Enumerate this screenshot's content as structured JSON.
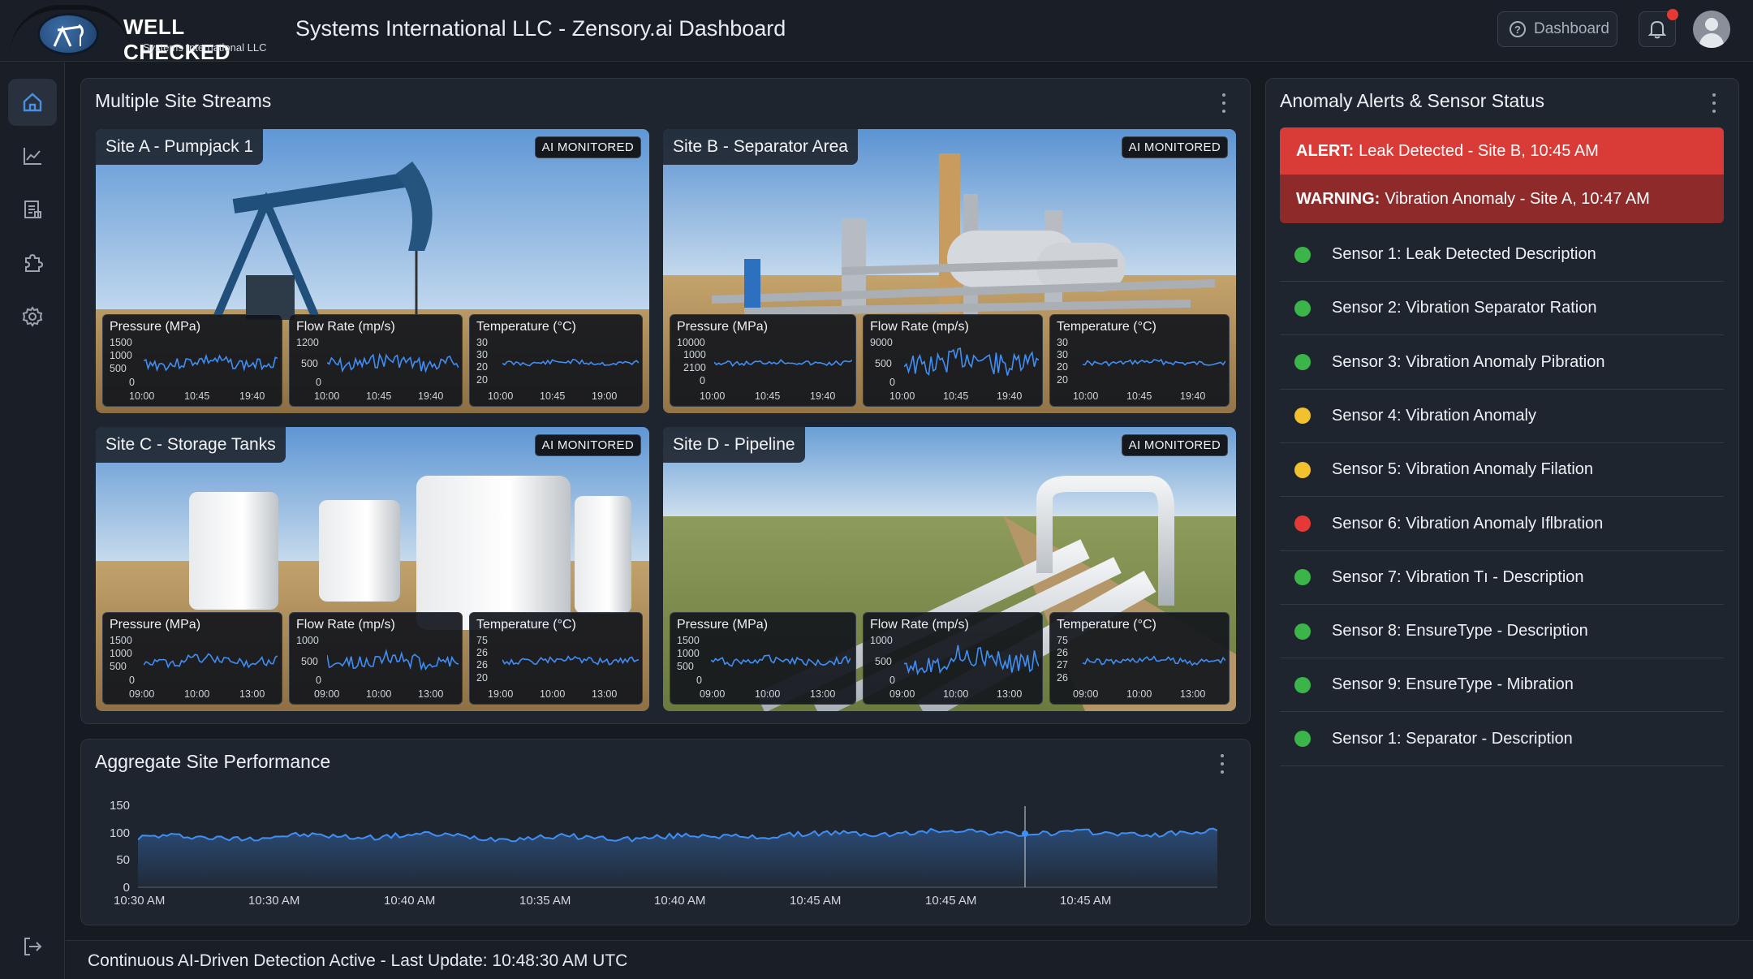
{
  "header": {
    "logo_title": "WELL CHECKED",
    "logo_subtitle": "Systems International LLC",
    "app_title": "Systems International LLC - Zensory.ai Dashboard",
    "dashboard_button": "Dashboard"
  },
  "sidebar": {
    "items": [
      {
        "icon": "home-icon",
        "active": true
      },
      {
        "icon": "chart-icon",
        "active": false
      },
      {
        "icon": "report-icon",
        "active": false
      },
      {
        "icon": "integrations-icon",
        "active": false
      },
      {
        "icon": "settings-icon",
        "active": false
      }
    ],
    "logout_icon": "logout-icon"
  },
  "streams": {
    "title": "Multiple Site Streams",
    "badge": "AI MONITORED",
    "sites": [
      {
        "name": "Site A - Pumpjack 1",
        "metrics": [
          {
            "title": "Pressure (MPa)",
            "yticks": [
              "1500",
              "1000",
              "500",
              "0"
            ],
            "xticks": [
              "10:00",
              "10:45",
              "19:40"
            ]
          },
          {
            "title": "Flow Rate (mp/s)",
            "yticks": [
              "1200",
              "500",
              "0"
            ],
            "xticks": [
              "10:00",
              "10:45",
              "19:40"
            ]
          },
          {
            "title": "Temperature (°C)",
            "yticks": [
              "30",
              "30",
              "20",
              "20"
            ],
            "xticks": [
              "10:00",
              "10:45",
              "19:00"
            ]
          }
        ]
      },
      {
        "name": "Site B - Separator Area",
        "metrics": [
          {
            "title": "Pressure (MPa)",
            "yticks": [
              "10000",
              "1000",
              "2100",
              "0"
            ],
            "xticks": [
              "10:00",
              "10:45",
              "19:40"
            ]
          },
          {
            "title": "Flow Rate (mp/s)",
            "yticks": [
              "9000",
              "500",
              "0"
            ],
            "xticks": [
              "10:00",
              "10:45",
              "19:40"
            ]
          },
          {
            "title": "Temperature (°C)",
            "yticks": [
              "30",
              "30",
              "20",
              "20"
            ],
            "xticks": [
              "10:00",
              "10:45",
              "19:40"
            ]
          }
        ]
      },
      {
        "name": "Site C - Storage Tanks",
        "metrics": [
          {
            "title": "Pressure (MPa)",
            "yticks": [
              "1500",
              "1000",
              "500",
              "0"
            ],
            "xticks": [
              "09:00",
              "10:00",
              "13:00"
            ]
          },
          {
            "title": "Flow Rate (mp/s)",
            "yticks": [
              "1000",
              "500",
              "0"
            ],
            "xticks": [
              "09:00",
              "10:00",
              "13:00"
            ]
          },
          {
            "title": "Temperature (°C)",
            "yticks": [
              "75",
              "26",
              "26",
              "20"
            ],
            "xticks": [
              "19:00",
              "10:00",
              "13:00"
            ]
          }
        ]
      },
      {
        "name": "Site D - Pipeline",
        "metrics": [
          {
            "title": "Pressure (MPa)",
            "yticks": [
              "1500",
              "1000",
              "500",
              "0"
            ],
            "xticks": [
              "09:00",
              "10:00",
              "13:00"
            ]
          },
          {
            "title": "Flow Rate (mp/s)",
            "yticks": [
              "1000",
              "500",
              "0"
            ],
            "xticks": [
              "09:00",
              "10:00",
              "13:00"
            ]
          },
          {
            "title": "Temperature (°C)",
            "yticks": [
              "75",
              "26",
              "27",
              "26"
            ],
            "xticks": [
              "09:00",
              "10:00",
              "13:00"
            ]
          }
        ]
      }
    ]
  },
  "alerts": {
    "title": "Anomaly Alerts & Sensor Status",
    "alert_label": "ALERT:",
    "alert_text": "Leak Detected - Site B, 10:45 AM",
    "warning_label": "WARNING:",
    "warning_text": "Vibration Anomaly - Site A, 10:47 AM",
    "sensors": [
      {
        "label": "Sensor 1: Leak Detected Description",
        "status": "ok"
      },
      {
        "label": "Sensor 2: Vibration Separator Ration",
        "status": "ok"
      },
      {
        "label": "Sensor 3: Vibration Anomaly Pibration",
        "status": "ok"
      },
      {
        "label": "Sensor 4: Vibration Anomaly",
        "status": "warning"
      },
      {
        "label": "Sensor 5: Vibration Anomaly Filation",
        "status": "warning"
      },
      {
        "label": "Sensor 6: Vibration Anomaly Iflbration",
        "status": "critical"
      },
      {
        "label": "Sensor 7: Vibration Tı - Description",
        "status": "ok"
      },
      {
        "label": "Sensor 8: EnsureType - Description",
        "status": "ok"
      },
      {
        "label": "Sensor 9: EnsureType - Mibration",
        "status": "ok"
      },
      {
        "label": "Sensor 1: Separator - Description",
        "status": "ok"
      }
    ],
    "status_colors": {
      "ok": "#3bb54a",
      "warning": "#f2c12e",
      "critical": "#e53935"
    }
  },
  "aggregate": {
    "title": "Aggregate Site Performance",
    "yticks": [
      "150",
      "100",
      "50",
      "0"
    ],
    "xticks": [
      "10:30 AM",
      "10:30 AM",
      "10:40 AM",
      "10:35 AM",
      "10:40 AM",
      "10:45 AM",
      "10:45 AM",
      "10:45 AM"
    ]
  },
  "chart_data": {
    "type": "area",
    "title": "Aggregate Site Performance",
    "categories": [
      "10:30 AM",
      "10:30 AM",
      "10:40 AM",
      "10:35 AM",
      "10:40 AM",
      "10:45 AM",
      "10:45 AM",
      "10:45 AM"
    ],
    "values": [
      92,
      93,
      96,
      91,
      93,
      97,
      103,
      99,
      101
    ],
    "ylim": [
      0,
      150
    ],
    "grid": false
  },
  "status_bar": "Continuous AI-Driven Detection Active - Last Update: 10:48:30 AM UTC",
  "colors": {
    "accent": "#3f8ef5",
    "alert": "#d93b37",
    "warning_bg": "#8e2a2a",
    "panel": "#1f252e"
  }
}
